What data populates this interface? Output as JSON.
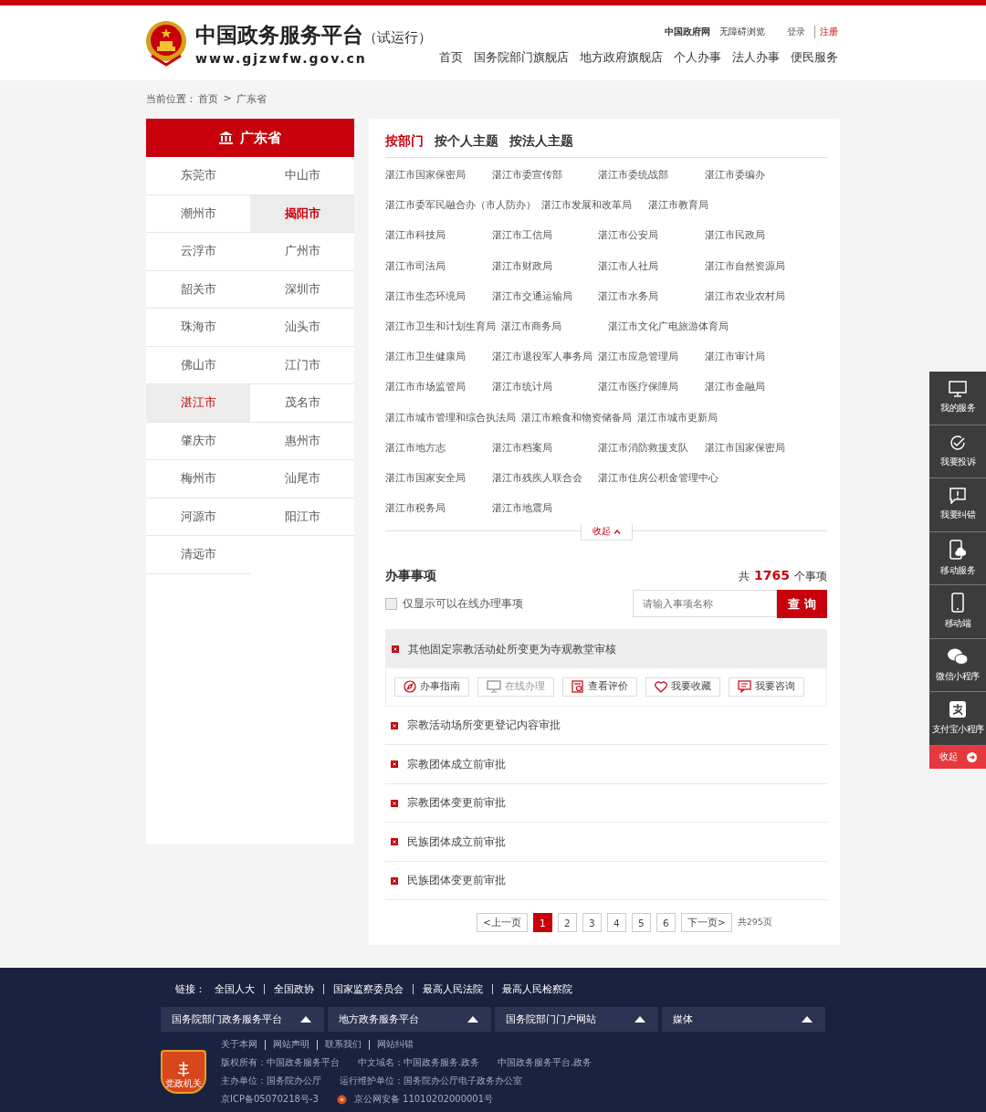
{
  "header": {
    "title": "中国政务服务平台",
    "trial": "（试运行）",
    "url": "www.gjzwfw.gov.cn",
    "top_links": [
      "中国政府网",
      "无障碍浏览"
    ],
    "login": "登录",
    "register": "注册",
    "nav": [
      "首页",
      "国务院部门旗舰店",
      "地方政府旗舰店",
      "个人办事",
      "法人办事",
      "便民服务"
    ]
  },
  "breadcrumb": {
    "label": "当前位置：",
    "items": [
      "首页",
      "广东省"
    ],
    "separator": ">"
  },
  "province": {
    "title": "广东省",
    "cities": [
      {
        "name": "东莞市",
        "selected": false,
        "hovered": false
      },
      {
        "name": "中山市",
        "selected": false,
        "hovered": false
      },
      {
        "name": "潮州市",
        "selected": false,
        "hovered": false
      },
      {
        "name": "揭阳市",
        "selected": true,
        "hovered": true
      },
      {
        "name": "云浮市",
        "selected": false,
        "hovered": false
      },
      {
        "name": "广州市",
        "selected": false,
        "hovered": false
      },
      {
        "name": "韶关市",
        "selected": false,
        "hovered": false
      },
      {
        "name": "深圳市",
        "selected": false,
        "hovered": false
      },
      {
        "name": "珠海市",
        "selected": false,
        "hovered": false
      },
      {
        "name": "汕头市",
        "selected": false,
        "hovered": false
      },
      {
        "name": "佛山市",
        "selected": false,
        "hovered": false
      },
      {
        "name": "江门市",
        "selected": false,
        "hovered": false
      },
      {
        "name": "湛江市",
        "selected": true,
        "hovered": false
      },
      {
        "name": "茂名市",
        "selected": false,
        "hovered": false
      },
      {
        "name": "肇庆市",
        "selected": false,
        "hovered": false
      },
      {
        "name": "惠州市",
        "selected": false,
        "hovered": false
      },
      {
        "name": "梅州市",
        "selected": false,
        "hovered": false
      },
      {
        "name": "汕尾市",
        "selected": false,
        "hovered": false
      },
      {
        "name": "河源市",
        "selected": false,
        "hovered": false
      },
      {
        "name": "阳江市",
        "selected": false,
        "hovered": false
      },
      {
        "name": "清远市",
        "selected": false,
        "hovered": false
      }
    ]
  },
  "tabs": [
    {
      "label": "按部门",
      "selected": true
    },
    {
      "label": "按个人主题",
      "selected": false
    },
    {
      "label": "按法人主题",
      "selected": false
    }
  ],
  "departments": [
    "湛江市国家保密局",
    "湛江市委宣传部",
    "湛江市委统战部",
    "湛江市委编办",
    "湛江市委军民融合办（市人防办）",
    "湛江市发展和改革局",
    "湛江市教育局",
    "湛江市科技局",
    "湛江市工信局",
    "湛江市公安局",
    "湛江市民政局",
    "湛江市司法局",
    "湛江市财政局",
    "湛江市人社局",
    "湛江市自然资源局",
    "湛江市生态环境局",
    "湛江市交通运输局",
    "湛江市水务局",
    "湛江市农业农村局",
    "湛江市卫生和计划生育局",
    "湛江市商务局",
    "湛江市文化广电旅游体育局",
    "湛江市卫生健康局",
    "湛江市退役军人事务局",
    "湛江市应急管理局",
    "湛江市审计局",
    "湛江市市场监管局",
    "湛江市统计局",
    "湛江市医疗保障局",
    "湛江市金融局",
    "湛江市城市管理和综合执法局",
    "湛江市粮食和物资储备局",
    "湛江市城市更新局",
    "湛江市地方志",
    "湛江市档案局",
    "湛江市消防救援支队",
    "湛江市国家保密局",
    "湛江市国家安全局",
    "湛江市残疾人联合会",
    "湛江市住房公积金管理中心",
    "湛江市税务局",
    "湛江市地震局"
  ],
  "collapse": "收起",
  "matters": {
    "title": "办事事项",
    "count_prefix": "共",
    "count": "1765",
    "count_suffix": "个事项",
    "online_only": {
      "label": "仅显示可以在线办理事项",
      "checked": false
    },
    "search": {
      "placeholder": "请输入事项名称",
      "button": "查 询"
    },
    "items": [
      {
        "title": "其他固定宗教活动处所变更为寺观教堂审核",
        "expanded": true,
        "actions": [
          {
            "kind": "guide",
            "label": "办事指南",
            "disabled": false
          },
          {
            "kind": "online",
            "label": "在线办理",
            "disabled": true
          },
          {
            "kind": "review",
            "label": "查看评价",
            "disabled": false
          },
          {
            "kind": "favorite",
            "label": "我要收藏",
            "disabled": false
          },
          {
            "kind": "consult",
            "label": "我要咨询",
            "disabled": false
          }
        ]
      },
      {
        "title": "宗教活动场所变更登记内容审批",
        "expanded": false
      },
      {
        "title": "宗教团体成立前审批",
        "expanded": false
      },
      {
        "title": "宗教团体变更前审批",
        "expanded": false
      },
      {
        "title": "民族团体成立前审批",
        "expanded": false
      },
      {
        "title": "民族团体变更前审批",
        "expanded": false
      }
    ]
  },
  "pagination": {
    "prev": "<上一页",
    "pages": [
      {
        "label": "1",
        "selected": true
      },
      {
        "label": "2",
        "selected": false
      },
      {
        "label": "3",
        "selected": false
      },
      {
        "label": "4",
        "selected": false
      },
      {
        "label": "5",
        "selected": false
      },
      {
        "label": "6",
        "selected": false
      }
    ],
    "next": "下一页>",
    "total": "共295页"
  },
  "side_bar": {
    "items": [
      {
        "kind": "monitor",
        "label": "我的服务"
      },
      {
        "kind": "complaint",
        "label": "我要投诉"
      },
      {
        "kind": "error",
        "label": "我要纠错"
      },
      {
        "kind": "mobile_service",
        "label": "移动服务"
      },
      {
        "kind": "phone",
        "label": "移动端"
      },
      {
        "kind": "wechat",
        "label": "微信小程序"
      },
      {
        "kind": "alipay",
        "label": "支付宝小程序"
      }
    ],
    "collapse": "收起"
  },
  "footer": {
    "links_label": "链接：",
    "links": [
      "全国人大",
      "全国政协",
      "国家监察委员会",
      "最高人民法院",
      "最高人民检察院"
    ],
    "dropdowns": [
      "国务院部门政务服务平台",
      "地方政务服务平台",
      "国务院部门门户网站",
      "媒体"
    ],
    "site_links": [
      "关于本网",
      "网站声明",
      "联系我们",
      "网站纠错"
    ],
    "badge": "党政机关",
    "info": [
      [
        "版权所有：中国政务服务平台",
        "中文域名：中国政务服务.政务",
        "中国政务服务平台.政务"
      ],
      [
        "主办单位：国务院办公厅",
        "运行维护单位：国务院办公厅电子政务办公室"
      ]
    ],
    "icp": "京ICP备05070218号-3",
    "police": "京公网安备 11010202000001号"
  }
}
